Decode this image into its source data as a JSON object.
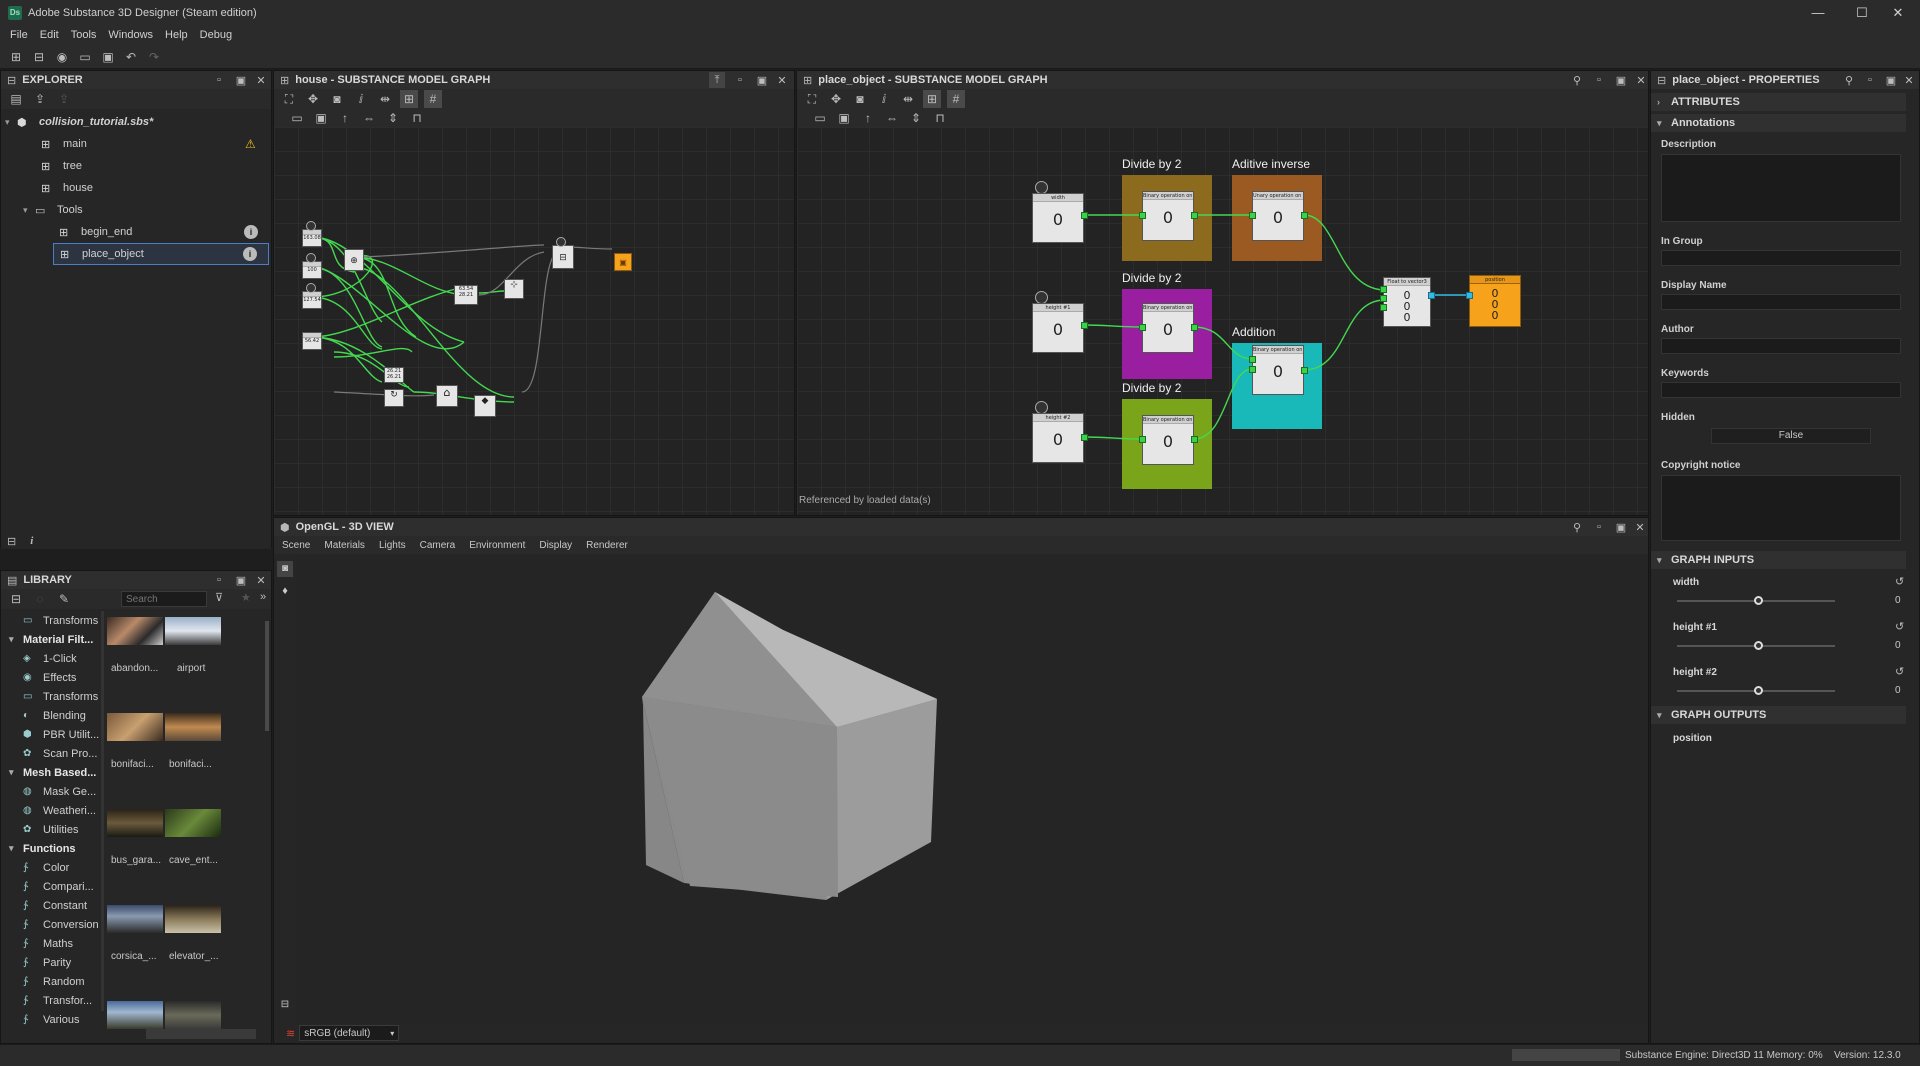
{
  "window": {
    "title": "Adobe Substance 3D Designer (Steam edition)",
    "logo": "Ds",
    "controls": {
      "minimize": "—",
      "maximize": "☐",
      "close": "✕"
    }
  },
  "menu": [
    "File",
    "Edit",
    "Tools",
    "Windows",
    "Help",
    "Debug"
  ],
  "explorer": {
    "title": "EXPLORER",
    "package": "collision_tutorial.sbs*",
    "items": [
      {
        "label": "main",
        "warning": "⚠"
      },
      {
        "label": "tree"
      },
      {
        "label": "house"
      },
      {
        "label": "Tools"
      },
      {
        "label": "begin_end"
      },
      {
        "label": "place_object"
      }
    ]
  },
  "house_graph": {
    "title": "house - SUBSTANCE MODEL GRAPH",
    "inputs": [
      "163.08",
      "100",
      "127.54",
      "56.42"
    ],
    "mid_node": "26.21\n26.21",
    "wide_node": "63.54\n28.21"
  },
  "place_graph": {
    "title": "place_object - SUBSTANCE MODEL GRAPH",
    "frames": {
      "f1": "Divide by 2",
      "f2": "Aditive inverse",
      "f3": "Divide by 2",
      "f4": "Addition",
      "f5": "Divide by 2"
    },
    "inputs": [
      {
        "title": "width",
        "value": "0"
      },
      {
        "title": "height #1",
        "value": "0"
      },
      {
        "title": "height #2",
        "value": "0"
      }
    ],
    "binary_node_title": "Binary operation on float",
    "unary_node_title": "Unary operation on float",
    "node_value": "0",
    "vector_node": {
      "title": "Float to vector3",
      "values": [
        "0",
        "0",
        "0"
      ]
    },
    "output_node": {
      "title": "position",
      "values": [
        "0",
        "0",
        "0"
      ]
    },
    "footer": "Referenced by loaded data(s)"
  },
  "view3d": {
    "title": "OpenGL - 3D VIEW",
    "menu": [
      "Scene",
      "Materials",
      "Lights",
      "Camera",
      "Environment",
      "Display",
      "Renderer"
    ],
    "colorspace": "sRGB (default)"
  },
  "library": {
    "title": "LIBRARY",
    "search_placeholder": "Search",
    "categories": [
      {
        "label": "Transforms",
        "level": 1
      },
      {
        "label": "Material Filt...",
        "level": 0
      },
      {
        "label": "1-Click",
        "level": 1
      },
      {
        "label": "Effects",
        "level": 1
      },
      {
        "label": "Transforms",
        "level": 1
      },
      {
        "label": "Blending",
        "level": 1
      },
      {
        "label": "PBR Utilit...",
        "level": 1
      },
      {
        "label": "Scan Pro...",
        "level": 1
      },
      {
        "label": "Mesh Based...",
        "level": 0
      },
      {
        "label": "Mask Ge...",
        "level": 1
      },
      {
        "label": "Weatheri...",
        "level": 1
      },
      {
        "label": "Utilities",
        "level": 1
      },
      {
        "label": "Functions",
        "level": 0
      },
      {
        "label": "Color",
        "level": 1
      },
      {
        "label": "Compari...",
        "level": 1
      },
      {
        "label": "Constant",
        "level": 1
      },
      {
        "label": "Conversion",
        "level": 1
      },
      {
        "label": "Maths",
        "level": 1
      },
      {
        "label": "Parity",
        "level": 1
      },
      {
        "label": "Random",
        "level": 1
      },
      {
        "label": "Transfor...",
        "level": 1
      },
      {
        "label": "Various",
        "level": 1
      }
    ],
    "thumbs": [
      "abandon...",
      "airport",
      "bonifaci...",
      "bonifaci...",
      "bus_gara...",
      "cave_ent...",
      "corsica_...",
      "elevator_..."
    ]
  },
  "properties": {
    "title": "place_object - PROPERTIES",
    "sections": {
      "attributes": "ATTRIBUTES",
      "annotations": "Annotations",
      "inputs": "GRAPH INPUTS",
      "outputs": "GRAPH OUTPUTS"
    },
    "fields": {
      "description": "Description",
      "in_group": "In Group",
      "display_name": "Display Name",
      "author": "Author",
      "keywords": "Keywords",
      "hidden": "Hidden",
      "hidden_value": "False",
      "copyright": "Copyright notice"
    },
    "inputs": [
      {
        "label": "width",
        "value": "0"
      },
      {
        "label": "height #1",
        "value": "0"
      },
      {
        "label": "height #2",
        "value": "0"
      }
    ],
    "outputs": [
      "position"
    ]
  },
  "status": {
    "engine": "Substance Engine: Direct3D 11  Memory: 0%",
    "version": "Version: 12.3.0"
  }
}
